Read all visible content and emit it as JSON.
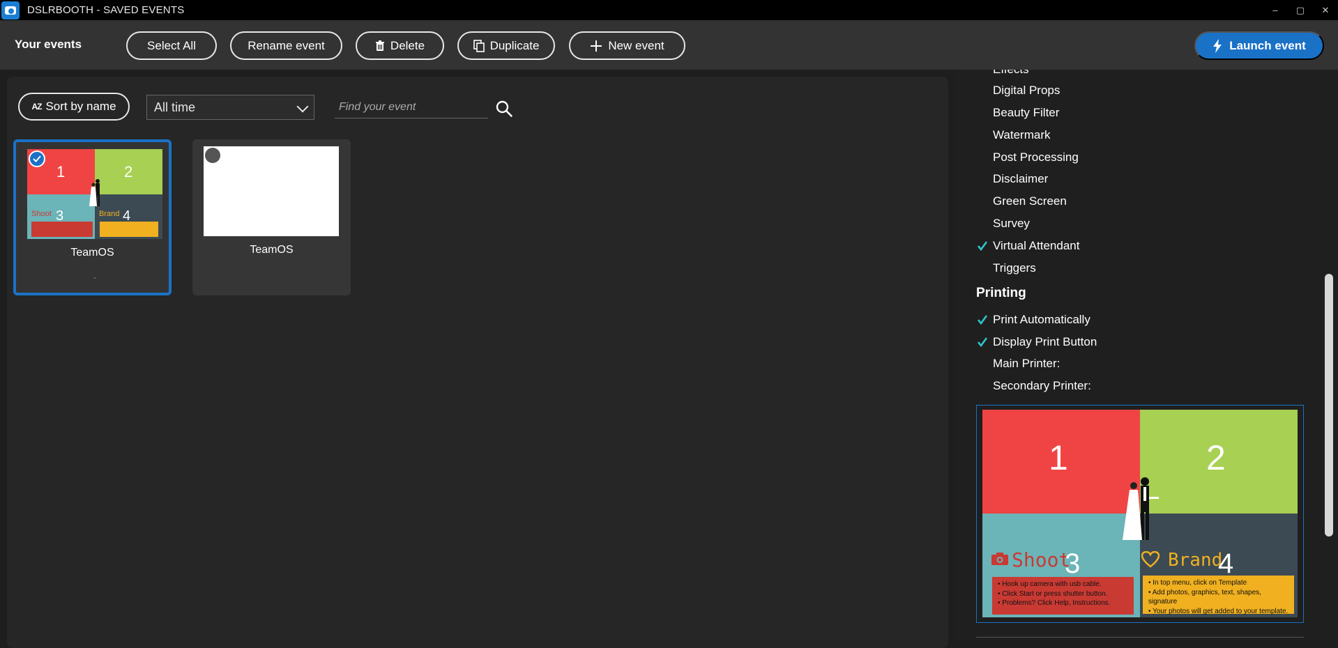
{
  "window": {
    "title": "DSLRBOOTH - SAVED EVENTS",
    "controls": {
      "minimize": "–",
      "maximize": "▢",
      "close": "✕"
    }
  },
  "toolbar": {
    "section_title": "Your events",
    "select_all": "Select All",
    "rename": "Rename event",
    "delete": "Delete",
    "duplicate": "Duplicate",
    "new_event": "New event",
    "launch": "Launch event"
  },
  "filters": {
    "sort_label": "Sort by name",
    "sort_icon_text": "AZ",
    "time_value": "All time",
    "search_placeholder": "Find your event"
  },
  "events": [
    {
      "name": "TeamOS",
      "selected": true
    },
    {
      "name": "TeamOS",
      "selected": false
    }
  ],
  "template": {
    "q1": "1",
    "q2": "2",
    "q3": "3",
    "q4": "4",
    "shoot_label": "Shoot",
    "brand_label": "Brand",
    "shoot_lines": [
      "• Hook up camera with usb cable.",
      "• Click Start or press shutter button.",
      "• Problems? Click Help, Instructions."
    ],
    "brand_lines": [
      "• In top menu, click on Template",
      "• Add photos, graphics, text, shapes, signature",
      "• Your photos will get added to your template."
    ],
    "colors": {
      "red": "#f04444",
      "green": "#a8d052",
      "teal": "#6bb4b8",
      "slate": "#3c4a53",
      "info_red": "#c93a33",
      "info_yellow": "#f0b020"
    }
  },
  "settings": {
    "features": [
      {
        "label": "Effects",
        "checked": false
      },
      {
        "label": "Digital Props",
        "checked": false
      },
      {
        "label": "Beauty Filter",
        "checked": false
      },
      {
        "label": "Watermark",
        "checked": false
      },
      {
        "label": "Post Processing",
        "checked": false
      },
      {
        "label": "Disclaimer",
        "checked": false
      },
      {
        "label": "Green Screen",
        "checked": false
      },
      {
        "label": "Survey",
        "checked": false
      },
      {
        "label": "Virtual Attendant",
        "checked": true
      },
      {
        "label": "Triggers",
        "checked": false
      }
    ],
    "printing_title": "Printing",
    "printing": [
      {
        "label": "Print Automatically",
        "checked": true
      },
      {
        "label": "Display Print Button",
        "checked": true
      },
      {
        "label": "Main Printer:",
        "checked": false
      },
      {
        "label": "Secondary Printer:",
        "checked": false
      }
    ]
  },
  "accent_color": "#1a72c7",
  "check_color": "#2fc6c8"
}
